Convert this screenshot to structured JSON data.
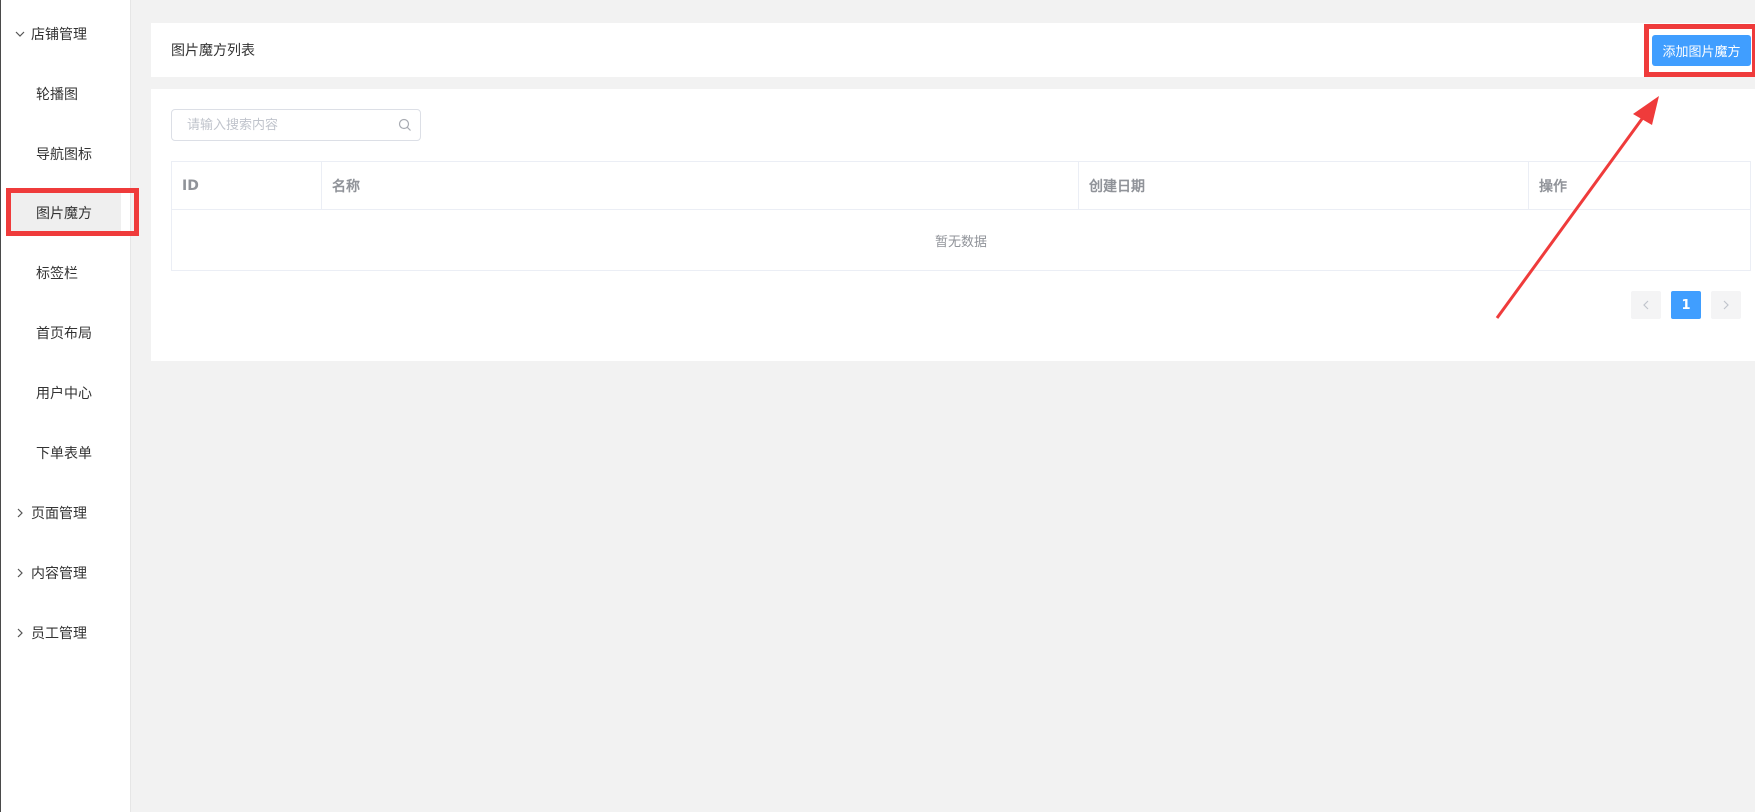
{
  "sidebar": {
    "groups": [
      {
        "label": "店铺管理",
        "expanded": true
      },
      {
        "label": "页面管理",
        "expanded": false
      },
      {
        "label": "内容管理",
        "expanded": false
      },
      {
        "label": "员工管理",
        "expanded": false
      }
    ],
    "items": [
      {
        "label": "轮播图"
      },
      {
        "label": "导航图标"
      },
      {
        "label": "图片魔方",
        "active": true
      },
      {
        "label": "标签栏"
      },
      {
        "label": "首页布局"
      },
      {
        "label": "用户中心"
      },
      {
        "label": "下单表单"
      }
    ]
  },
  "header": {
    "title": "图片魔方列表",
    "add_button": "添加图片魔方"
  },
  "search": {
    "placeholder": "请输入搜索内容",
    "value": ""
  },
  "table": {
    "columns": [
      "ID",
      "名称",
      "创建日期",
      "操作"
    ],
    "rows": [],
    "empty_text": "暂无数据"
  },
  "pagination": {
    "current_page": "1"
  },
  "colors": {
    "primary": "#409eff",
    "annotation": "#ef3b3b",
    "background": "#f2f2f2"
  }
}
